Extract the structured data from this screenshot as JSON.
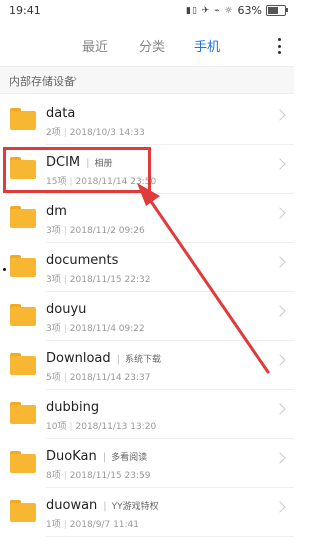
{
  "status_bar": {
    "time": "19:41",
    "icons": "▮▯ ✈ ⌁ ☼",
    "battery_percent": "63%",
    "battery_level": 0.63
  },
  "tabs": [
    {
      "label": "最近",
      "active": false
    },
    {
      "label": "分类",
      "active": false
    },
    {
      "label": "手机",
      "active": true
    }
  ],
  "breadcrumb": {
    "label": "内部存储设备",
    "chevron": "›"
  },
  "files": [
    {
      "name": "data",
      "tag": "",
      "count": "2项",
      "date": "2018/10/3 14:33"
    },
    {
      "name": "DCIM",
      "tag": "相册",
      "count": "15项",
      "date": "2018/11/14 23:50"
    },
    {
      "name": "dm",
      "tag": "",
      "count": "3项",
      "date": "2018/11/2 09:26"
    },
    {
      "name": "documents",
      "tag": "",
      "count": "3项",
      "date": "2018/11/15 22:32"
    },
    {
      "name": "douyu",
      "tag": "",
      "count": "3项",
      "date": "2018/11/4 09:22"
    },
    {
      "name": "Download",
      "tag": "系统下载",
      "count": "5项",
      "date": "2018/11/14 23:37"
    },
    {
      "name": "dubbing",
      "tag": "",
      "count": "10项",
      "date": "2018/11/13 13:20"
    },
    {
      "name": "DuoKan",
      "tag": "多看阅读",
      "count": "8项",
      "date": "2018/11/15 23:59"
    },
    {
      "name": "duowan",
      "tag": "YY游戏特权",
      "count": "1项",
      "date": "2018/9/7 11:41"
    }
  ],
  "colors": {
    "accent": "#1a73e8",
    "folder": "#f7b733",
    "annotation": "#e03a3a"
  },
  "icons": {
    "folder": "folder-icon",
    "more": "more-vertical-icon",
    "chevron": "chevron-right-icon"
  }
}
